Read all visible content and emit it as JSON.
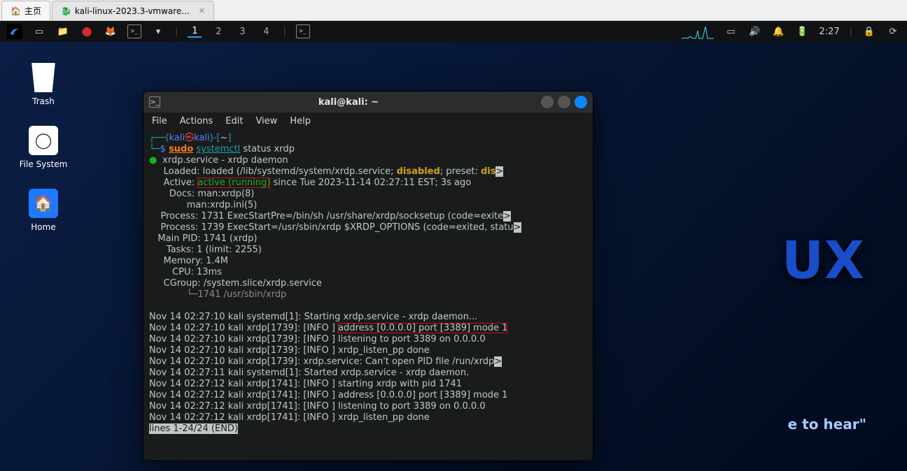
{
  "vmware": {
    "tab_home": "主页",
    "tab_vm": "kali-linux-2023.3-vmware..."
  },
  "panel": {
    "workspaces": [
      "1",
      "2",
      "3",
      "4"
    ],
    "active_ws": 0,
    "time": "2:27"
  },
  "wallpaper": {
    "big": "UX",
    "quiet": "e to hear\""
  },
  "desktop_icons": {
    "trash": "Trash",
    "fs": "File System",
    "home": "Home"
  },
  "terminal": {
    "title": "kali@kali: ~",
    "menus": [
      "File",
      "Actions",
      "Edit",
      "View",
      "Help"
    ],
    "prompt": {
      "user": "kali",
      "host": "kali",
      "path": "~",
      "sep": "㉿"
    },
    "cmd": {
      "sudo": "sudo",
      "rest": "systemctl status xrdp"
    },
    "status": {
      "bullet": "●",
      "unit_line": "xrdp.service - xrdp daemon",
      "loaded_lbl": "     Loaded:",
      "loaded_val1": " loaded (/lib/systemd/system/xrdp.service; ",
      "loaded_dis": "disabled",
      "loaded_val2": "; preset: ",
      "preset": "dis",
      "active_lbl": "     Active:",
      "active_pre": " ",
      "active_val": "active (running)",
      "active_post": " since Tue 2023-11-14 02:27:11 EST; 3s ago",
      "docs": "       Docs: man:xrdp(8)\n             man:xrdp.ini(5)",
      "proc1": "    Process: 1731 ExecStartPre=/bin/sh /usr/share/xrdp/socksetup (code=exite",
      "proc2": "    Process: 1739 ExecStart=/usr/sbin/xrdp $XRDP_OPTIONS (code=exited, statu",
      "mainpid": "   Main PID: 1741 (xrdp)",
      "tasks": "      Tasks: 1 (limit: 2255)",
      "mem": "     Memory: 1.4M",
      "cpu": "        CPU: 13ms",
      "cgroup": "     CGroup: /system.slice/xrdp.service",
      "cgroup_child": "             └─1741 /usr/sbin/xrdp"
    },
    "log": [
      "Nov 14 02:27:10 kali systemd[1]: Starting xrdp.service - xrdp daemon...",
      "Nov 14 02:27:10 kali xrdp[1739]: [INFO ] ",
      "address [0.0.0.0] port [3389] mode 1",
      "Nov 14 02:27:10 kali xrdp[1739]: [INFO ] listening to port 3389 on 0.0.0.0",
      "Nov 14 02:27:10 kali xrdp[1739]: [INFO ] xrdp_listen_pp done",
      "Nov 14 02:27:10 kali xrdp[1739]: xrdp.service: Can't open PID file /run/xrdp",
      "Nov 14 02:27:11 kali systemd[1]: Started xrdp.service - xrdp daemon.",
      "Nov 14 02:27:12 kali xrdp[1741]: [INFO ] starting xrdp with pid 1741",
      "Nov 14 02:27:12 kali xrdp[1741]: [INFO ] address [0.0.0.0] port [3389] mode 1",
      "Nov 14 02:27:12 kali xrdp[1741]: [INFO ] listening to port 3389 on 0.0.0.0",
      "Nov 14 02:27:12 kali xrdp[1741]: [INFO ] xrdp_listen_pp done"
    ],
    "pager": "lines 1-24/24 (END)"
  }
}
